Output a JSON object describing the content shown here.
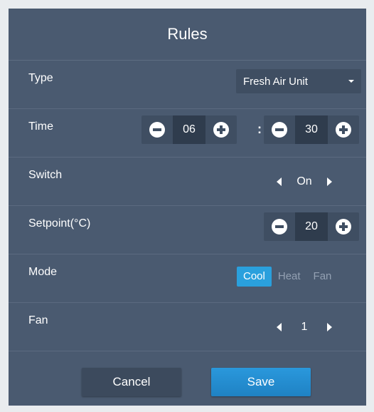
{
  "dialog": {
    "title": "Rules"
  },
  "rows": {
    "type": {
      "label": "Type",
      "value": "Fresh Air Unit"
    },
    "time": {
      "label": "Time",
      "hour": "06",
      "separator": ":",
      "minute": "30"
    },
    "switch": {
      "label": "Switch",
      "value": "On"
    },
    "setpoint": {
      "label": "Setpoint(°C)",
      "value": "20"
    },
    "mode": {
      "label": "Mode",
      "options": [
        "Cool",
        "Heat",
        "Fan"
      ],
      "selected": "Cool"
    },
    "fan": {
      "label": "Fan",
      "value": "1"
    }
  },
  "footer": {
    "cancel_label": "Cancel",
    "save_label": "Save"
  },
  "colors": {
    "background": "#4a5a70",
    "control": "#3f4e62",
    "accent": "#2aa0dd",
    "inactive_text": "#93a0b2"
  },
  "icons": {
    "dropdown": "caret-down-icon",
    "decrement": "minus-circle-icon",
    "increment": "plus-circle-icon",
    "previous": "triangle-left-icon",
    "next": "triangle-right-icon"
  }
}
